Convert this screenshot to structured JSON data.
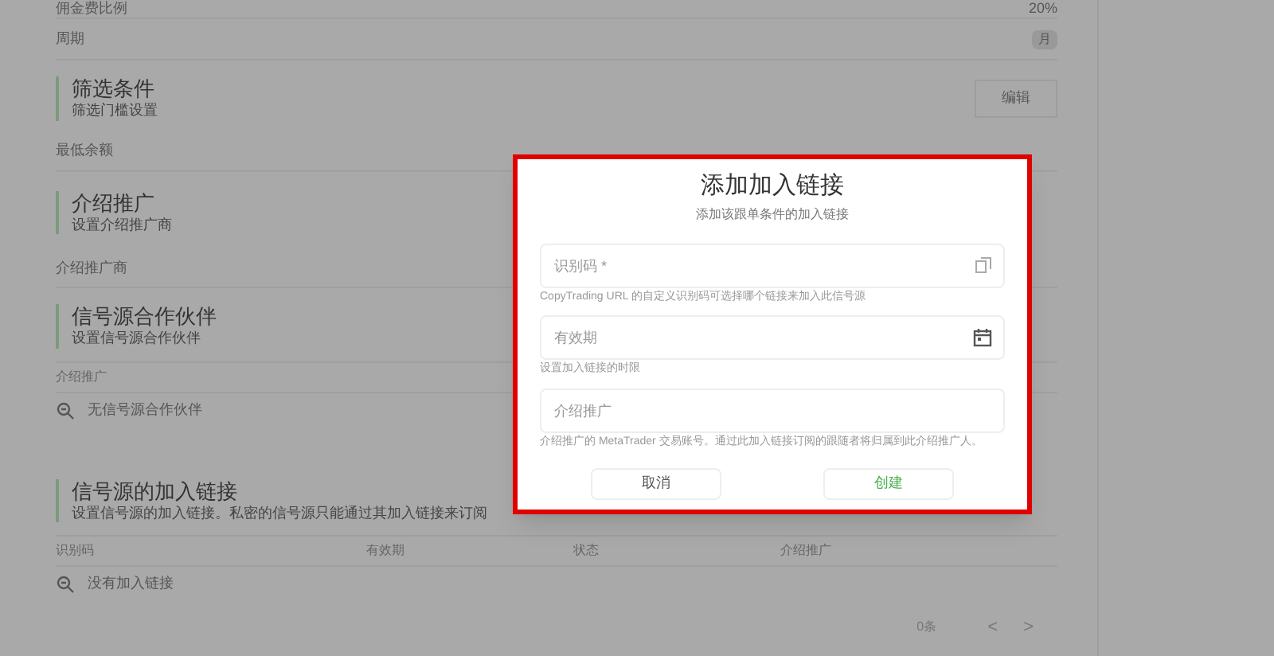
{
  "rows_top": [
    {
      "label": "佣金费比例",
      "value": "20%",
      "kind": "text"
    },
    {
      "label": "周期",
      "value": "月",
      "kind": "badge"
    }
  ],
  "filter_section": {
    "title": "筛选条件",
    "subtitle": "筛选门槛设置",
    "button": "编辑"
  },
  "min_balance_label": "最低余额",
  "intro_section": {
    "title": "介绍推广",
    "subtitle": "设置介绍推广商"
  },
  "intro_label": "介绍推广商",
  "partner_section": {
    "title": "信号源合作伙伴",
    "subtitle": "设置信号源合作伙伴",
    "column": "介绍推广",
    "empty": "无信号源合作伙伴"
  },
  "links_section": {
    "title": "信号源的加入链接",
    "subtitle": "设置信号源的加入链接。私密的信号源只能通过其加入链接来订阅",
    "columns": [
      "识别码",
      "有效期",
      "状态",
      "介绍推广"
    ],
    "empty": "没有加入链接"
  },
  "pagination": {
    "count": "0条",
    "prev": "<",
    "next": ">"
  },
  "dialog": {
    "title": "添加加入链接",
    "subtitle": "添加该跟单条件的加入链接",
    "fields": [
      {
        "placeholder": "识别码 *",
        "hint": "CopyTrading URL 的自定义识别码可选择哪个链接来加入此信号源",
        "kind": "copy"
      },
      {
        "placeholder": "有效期",
        "hint": "设置加入链接的时限",
        "kind": "date"
      },
      {
        "placeholder": "介绍推广",
        "hint": "介绍推广的 MetaTrader 交易账号。通过此加入链接订阅的跟随者将归属到此介绍推广人。",
        "kind": "text"
      }
    ],
    "cancel": "取消",
    "create": "创建"
  }
}
